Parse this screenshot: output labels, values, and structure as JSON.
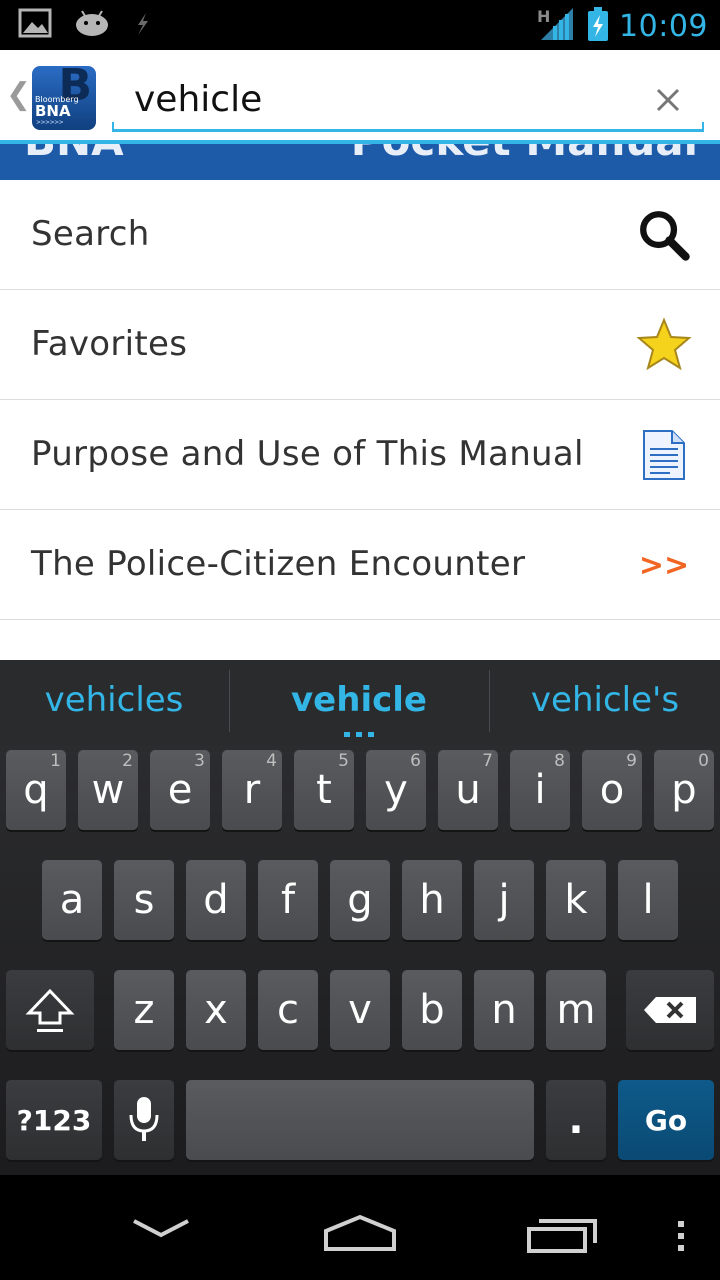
{
  "status_bar": {
    "time": "10:09",
    "network_type": "H",
    "icons": [
      "gallery-icon",
      "android-icon",
      "usb-debug-icon",
      "signal-icon",
      "battery-charging-icon"
    ]
  },
  "action_bar": {
    "app_logo": {
      "line1": "Bloomberg",
      "line2": "BNA",
      "line3": ">>>>>>"
    },
    "search_value": "vehicle"
  },
  "banner": {
    "left_text": "BNA",
    "right_text": "Pocket Manual"
  },
  "menu": {
    "items": [
      {
        "label": "Search",
        "icon": "search-icon"
      },
      {
        "label": "Favorites",
        "icon": "star-icon"
      },
      {
        "label": "Purpose and Use of This Manual",
        "icon": "document-icon"
      },
      {
        "label": "The Police-Citizen Encounter",
        "icon": "double-chevron-icon",
        "icon_text": ">>"
      }
    ]
  },
  "keyboard": {
    "suggestions": [
      "vehicles",
      "vehicle",
      "vehicle's"
    ],
    "row1": [
      {
        "key": "q",
        "hint": "1"
      },
      {
        "key": "w",
        "hint": "2"
      },
      {
        "key": "e",
        "hint": "3"
      },
      {
        "key": "r",
        "hint": "4"
      },
      {
        "key": "t",
        "hint": "5"
      },
      {
        "key": "y",
        "hint": "6"
      },
      {
        "key": "u",
        "hint": "7"
      },
      {
        "key": "i",
        "hint": "8"
      },
      {
        "key": "o",
        "hint": "9"
      },
      {
        "key": "p",
        "hint": "0"
      }
    ],
    "row2": [
      "a",
      "s",
      "d",
      "f",
      "g",
      "h",
      "j",
      "k",
      "l"
    ],
    "row3": [
      "z",
      "x",
      "c",
      "v",
      "b",
      "n",
      "m"
    ],
    "symbols_label": "?123",
    "period_label": ".",
    "go_label": "Go"
  },
  "colors": {
    "accent": "#33b5e5",
    "banner": "#1d5aa8",
    "chevron": "#f26522",
    "go_key": "#0e5a8a"
  }
}
